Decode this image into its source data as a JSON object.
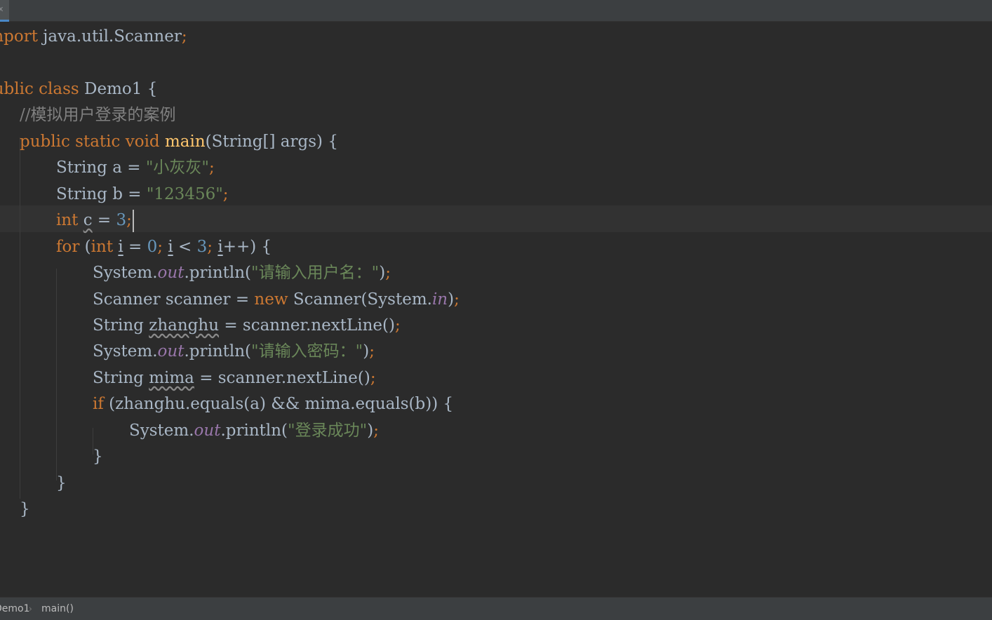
{
  "tab": {
    "label": "x"
  },
  "code": {
    "l1": {
      "kw_import": "import",
      "text": " java.util.Scanner",
      "semi": ";"
    },
    "l3": {
      "kw_public": "public",
      "kw_class": "class",
      "name": "Demo1",
      "brace": "{"
    },
    "l4": {
      "comment": "//模拟用户登录的案例"
    },
    "l5": {
      "kw_public": "public",
      "kw_static": "static",
      "kw_void": "void",
      "method": "main",
      "params": "(String[] args)",
      "brace": "{"
    },
    "l6": {
      "lhs": "String a = ",
      "str": "\"小灰灰\"",
      "semi": ";"
    },
    "l7": {
      "lhs": "String b = ",
      "str": "\"123456\"",
      "semi": ";"
    },
    "l8": {
      "kw_int": "int",
      "var": "c",
      "eq": " = ",
      "num": "3",
      "semi": ";"
    },
    "l9": {
      "kw_for": "for",
      "paren": " (",
      "kw_int": "int",
      "var_i1": "i",
      "eq": " = ",
      "num0": "0",
      "semi1": ";",
      "var_i2": "i",
      "lt": " < ",
      "num3": "3",
      "semi2": ";",
      "var_i3": "i",
      "incr": "++) {"
    },
    "l10": {
      "sys": "System.",
      "out": "out",
      "call": ".println(",
      "str": "\"请输入用户名：\"",
      "close": ")",
      "semi": ";"
    },
    "l11": {
      "lhs": "Scanner scanner = ",
      "kw_new": "new",
      "ctor": " Scanner(System.",
      "fld_in": "in",
      "close": ")",
      "semi": ";"
    },
    "l12": {
      "type": "String ",
      "var": "zhanghu",
      "rhs": " = scanner.nextLine()",
      "semi": ";"
    },
    "l13": {
      "sys": "System.",
      "out": "out",
      "call": ".println(",
      "str": "\"请输入密码：\"",
      "close": ")",
      "semi": ";"
    },
    "l14": {
      "type": "String ",
      "var": "mima",
      "rhs": " = scanner.nextLine()",
      "semi": ";"
    },
    "l15": {
      "kw_if": "if",
      "cond": " (zhanghu.equals(a) && mima.equals(b)) {"
    },
    "l16": {
      "sys": "System.",
      "out": "out",
      "call": ".println(",
      "str": "\"登录成功\"",
      "close": ")",
      "semi": ";"
    },
    "l17": {
      "brace": "}"
    },
    "l18": {
      "brace": "}"
    },
    "l19": {
      "brace": "}"
    }
  },
  "breadcrumb": {
    "class_name": "Demo1",
    "separator": "›",
    "method": "main()"
  },
  "colors": {
    "background": "#2b2b2b",
    "keyword": "#cc7832",
    "string": "#6a8759",
    "number": "#6897bb",
    "comment": "#808080",
    "static_field": "#9876aa",
    "method_decl": "#ffc66d",
    "default_text": "#a9b7c6",
    "caret_row": "#323232"
  }
}
